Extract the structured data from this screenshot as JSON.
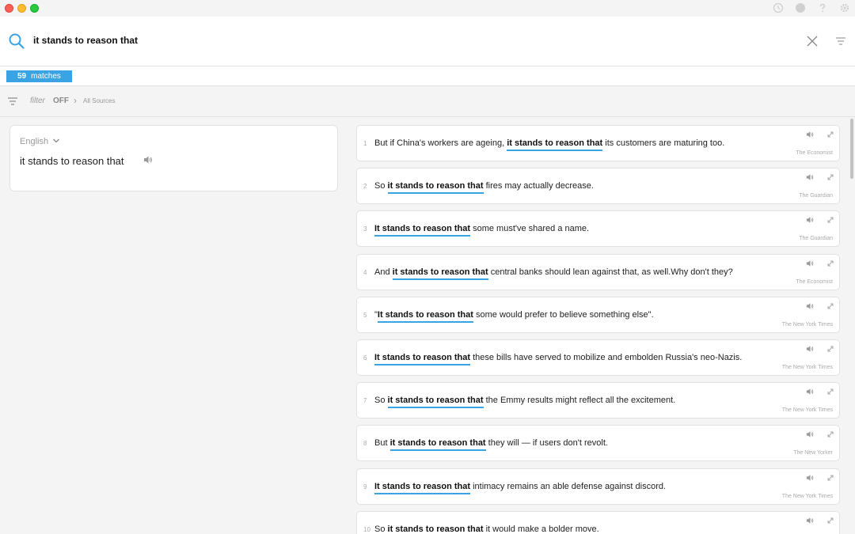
{
  "window": {
    "titlebar_icons": [
      "history-icon",
      "account-icon",
      "help-icon",
      "settings-icon"
    ]
  },
  "search": {
    "query": "it stands to reason that"
  },
  "matches": {
    "count": "59",
    "label": "matches"
  },
  "filter": {
    "label": "filter",
    "state": "OFF",
    "sources": "All Sources"
  },
  "query_panel": {
    "language": "English",
    "phrase": "it stands to reason that"
  },
  "results": [
    {
      "num": "1",
      "before": "But if China's workers are ageing, ",
      "match": "it stands to reason that",
      "after": " its customers are maturing too.",
      "source": "The Economist"
    },
    {
      "num": "2",
      "before": "So ",
      "match": "it stands to reason that",
      "after": " fires may actually decrease.",
      "source": "The Guardian"
    },
    {
      "num": "3",
      "before": "",
      "match": "It stands to reason that",
      "after": " some must've shared a name.",
      "source": "The Guardian"
    },
    {
      "num": "4",
      "before": "And ",
      "match": "it stands to reason that",
      "after": " central banks should lean against that, as well.Why don't they?",
      "source": "The Economist"
    },
    {
      "num": "5",
      "before": "\"",
      "match": "It stands to reason that",
      "after": " some would prefer to believe something else\".",
      "source": "The New York Times"
    },
    {
      "num": "6",
      "before": "",
      "match": "It stands to reason that",
      "after": " these bills have served to mobilize and embolden Russia's neo-Nazis.",
      "source": "The New York Times"
    },
    {
      "num": "7",
      "before": "So ",
      "match": "it stands to reason that",
      "after": " the Emmy results might reflect all the excitement.",
      "source": "The New York Times"
    },
    {
      "num": "8",
      "before": "But ",
      "match": "it stands to reason that",
      "after": " they will — if users don't revolt.",
      "source": "The New Yorker"
    },
    {
      "num": "9",
      "before": "",
      "match": "It stands to reason that",
      "after": " intimacy remains an able defense against discord.",
      "source": "The New York Times"
    },
    {
      "num": "10",
      "before": "So ",
      "match": "it stands to reason that",
      "after": " it would make a bolder move.",
      "source": ""
    }
  ],
  "colors": {
    "accent": "#3aa3e3",
    "close": "#fe5f57",
    "minimize": "#febc2e",
    "zoom": "#28c840"
  }
}
